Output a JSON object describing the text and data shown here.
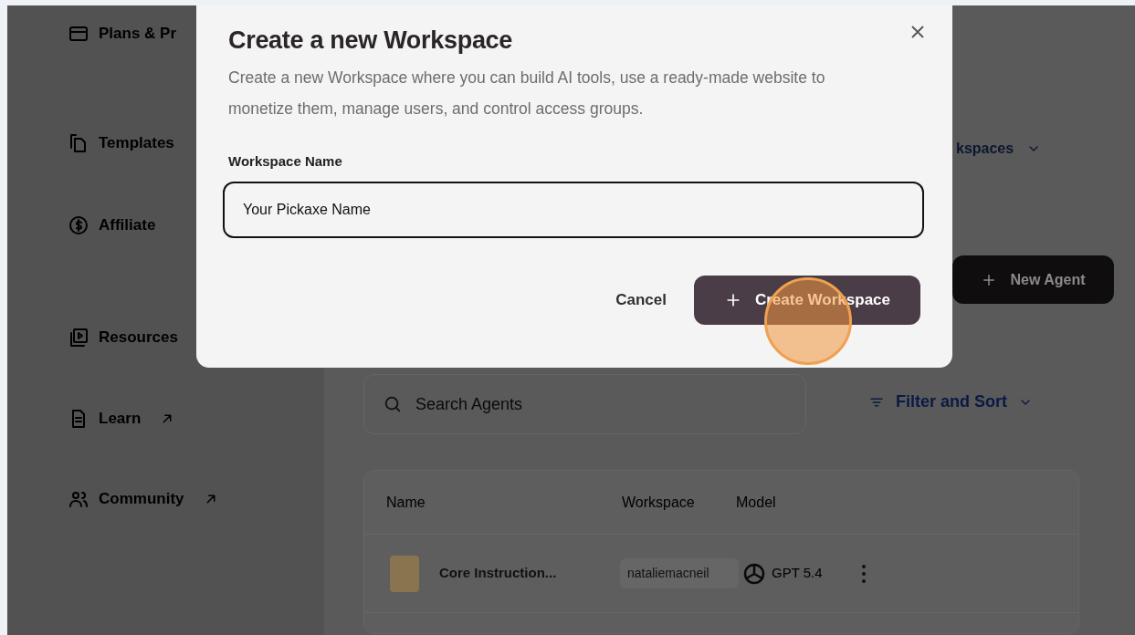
{
  "sidebar": {
    "items": [
      {
        "label": "Plans & Pr"
      },
      {
        "label": "Templates"
      },
      {
        "label": "Affiliate",
        "external": false
      },
      {
        "label": "Resources"
      },
      {
        "label": "Learn",
        "external": true
      },
      {
        "label": "Community",
        "external": true
      }
    ]
  },
  "main": {
    "workspaces_filter": "kspaces",
    "new_agent_button": "New Agent",
    "search": {
      "placeholder": "Search Agents"
    },
    "filter_button": "Filter and Sort",
    "table": {
      "columns": [
        "Name",
        "Workspace",
        "Model"
      ],
      "rows": [
        {
          "name": "Core Instruction...",
          "workspace": "nataliemacneil",
          "model": "GPT 5.4"
        }
      ]
    }
  },
  "modal": {
    "title": "Create a new Workspace",
    "description": "Create a new Workspace where you can build AI tools, use a ready-made website to monetize them, manage users, and control access groups.",
    "field": {
      "label": "Workspace Name",
      "value": "Your Pickaxe Name"
    },
    "buttons": [
      {
        "label": "Cancel",
        "kind": "secondary"
      },
      {
        "label": "Create Workspace",
        "kind": "primary"
      }
    ]
  }
}
